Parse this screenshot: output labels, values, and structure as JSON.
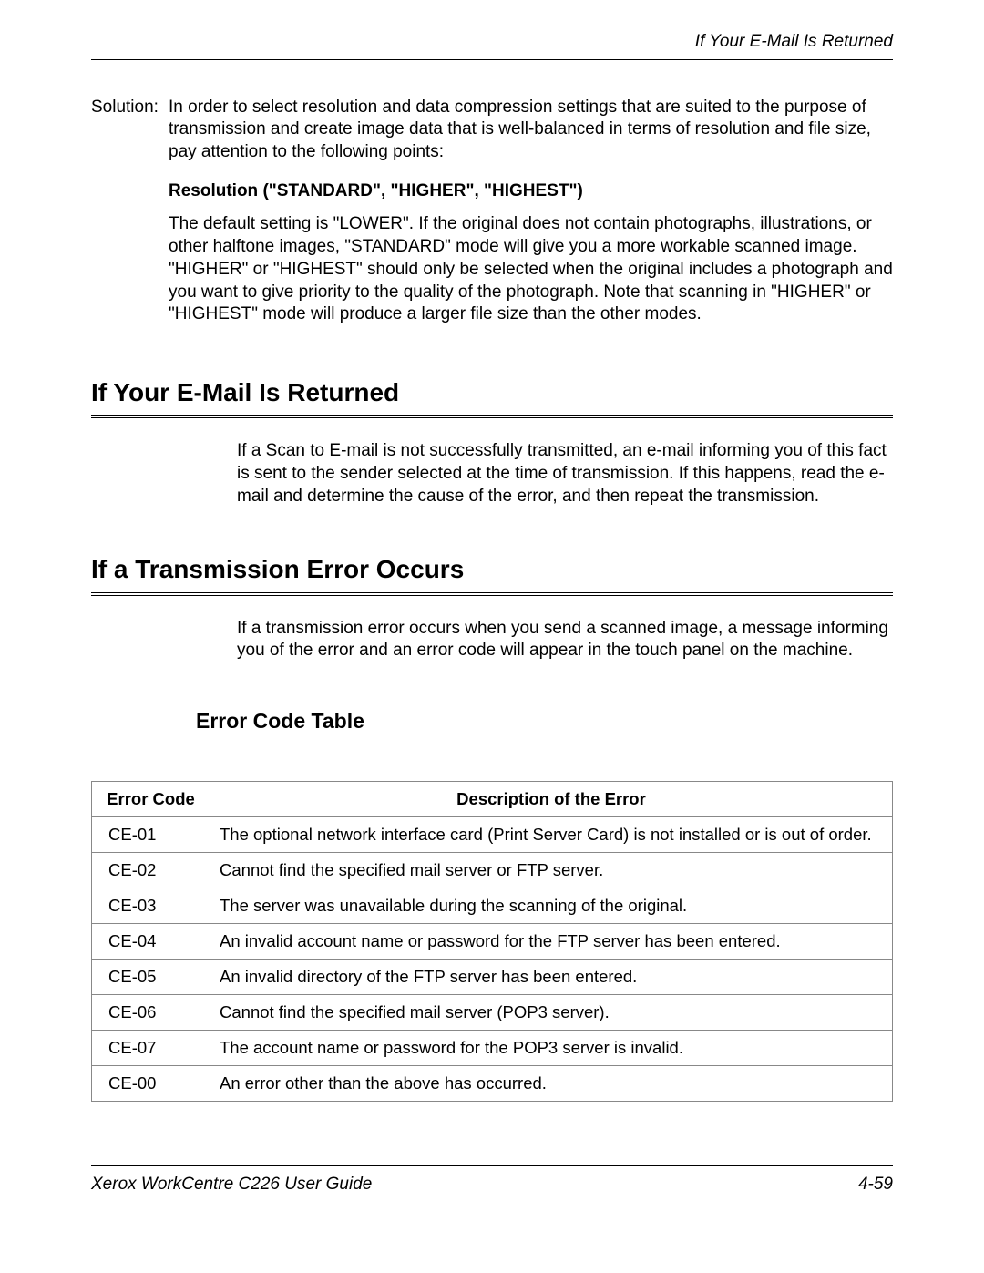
{
  "header": {
    "running_title": "If Your E-Mail Is Returned"
  },
  "solution": {
    "label": "Solution:",
    "text": "In order to select resolution and data compression settings that are suited to the purpose of transmission and create image data that is well-balanced in terms of resolution and file size, pay attention to the following points:",
    "bold_sub": "Resolution (\"STANDARD\", \"HIGHER\", \"HIGHEST\")",
    "res_body": "The default setting is \"LOWER\". If the original does not contain photographs, illustrations, or other halftone images, \"STANDARD\" mode will give you a more workable scanned image. \"HIGHER\" or \"HIGHEST\" should only be selected when the original includes a photograph and you want to give priority to the quality of the photograph. Note that scanning in \"HIGHER\" or \"HIGHEST\" mode will produce a larger file size than the other modes."
  },
  "section1": {
    "title": "If Your E-Mail Is Returned",
    "body": "If a Scan to E-mail is not successfully transmitted, an e-mail informing you of this fact is sent to the sender selected at the time of transmission. If this happens, read the e-mail and determine the cause of the error, and then repeat the transmission."
  },
  "section2": {
    "title": "If a Transmission Error Occurs",
    "body": "If a transmission error occurs when you send a scanned image, a message informing you of the error and an error code will appear in the touch panel on the machine.",
    "subsection": "Error Code Table"
  },
  "table": {
    "head_code": "Error Code",
    "head_desc": "Description of the Error",
    "rows": [
      {
        "code": "CE-01",
        "desc": "The optional network interface card (Print Server Card) is not installed or is out  of order."
      },
      {
        "code": "CE-02",
        "desc": "Cannot find the specified mail server or FTP server."
      },
      {
        "code": "CE-03",
        "desc": "The server was unavailable during the scanning of the original."
      },
      {
        "code": "CE-04",
        "desc": "An invalid account name or password for the FTP server has been entered."
      },
      {
        "code": "CE-05",
        "desc": "An invalid directory of the FTP server has been entered."
      },
      {
        "code": "CE-06",
        "desc": "Cannot find the specified mail server (POP3 server)."
      },
      {
        "code": "CE-07",
        "desc": "The account name or password for the POP3 server is invalid."
      },
      {
        "code": "CE-00",
        "desc": "An error other than the above has occurred."
      }
    ]
  },
  "footer": {
    "left": "Xerox WorkCentre C226 User Guide",
    "right": "4-59"
  }
}
